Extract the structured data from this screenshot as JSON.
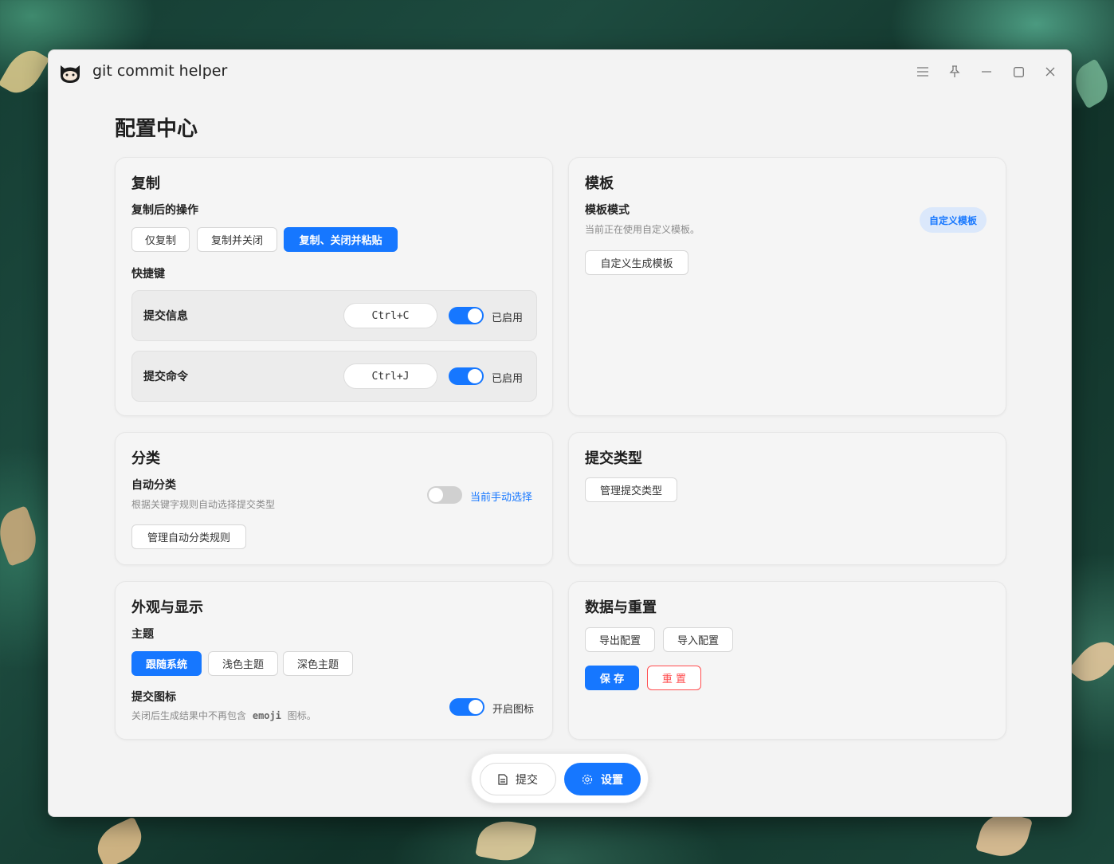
{
  "window": {
    "title": "git commit helper"
  },
  "page": {
    "title": "配置中心"
  },
  "copy": {
    "title": "复制",
    "after_copy_label": "复制后的操作",
    "options": [
      "仅复制",
      "复制并关闭",
      "复制、关闭并粘贴"
    ],
    "selected_option": "复制、关闭并粘贴",
    "shortcut_label": "快捷键",
    "shortcuts": [
      {
        "name": "提交信息",
        "key": "Ctrl+C",
        "status": "已启用"
      },
      {
        "name": "提交命令",
        "key": "Ctrl+J",
        "status": "已启用"
      }
    ]
  },
  "template": {
    "title": "模板",
    "mode_label": "模板模式",
    "mode_desc": "当前正在使用自定义模板。",
    "badge": "自定义模板",
    "button": "自定义生成模板"
  },
  "category": {
    "title": "分类",
    "auto_label": "自动分类",
    "auto_desc": "根据关键字规则自动选择提交类型",
    "toggle_status": "当前手动选择",
    "button": "管理自动分类规则"
  },
  "commit_type": {
    "title": "提交类型",
    "button": "管理提交类型"
  },
  "appearance": {
    "title": "外观与显示",
    "theme_label": "主题",
    "themes": [
      "跟随系统",
      "浅色主题",
      "深色主题"
    ],
    "selected_theme": "跟随系统",
    "icon_label": "提交图标",
    "icon_desc_prefix": "关闭后生成结果中不再包含",
    "icon_desc_code": "emoji",
    "icon_desc_suffix": "图标。",
    "icon_toggle": "开启图标"
  },
  "data_reset": {
    "title": "数据与重置",
    "export": "导出配置",
    "import": "导入配置",
    "save": "保 存",
    "reset": "重 置"
  },
  "dock": {
    "submit": "提交",
    "settings": "设置"
  },
  "colors": {
    "accent": "#1677ff",
    "danger": "#ff4d4f",
    "window_bg": "#f3f3f3"
  }
}
